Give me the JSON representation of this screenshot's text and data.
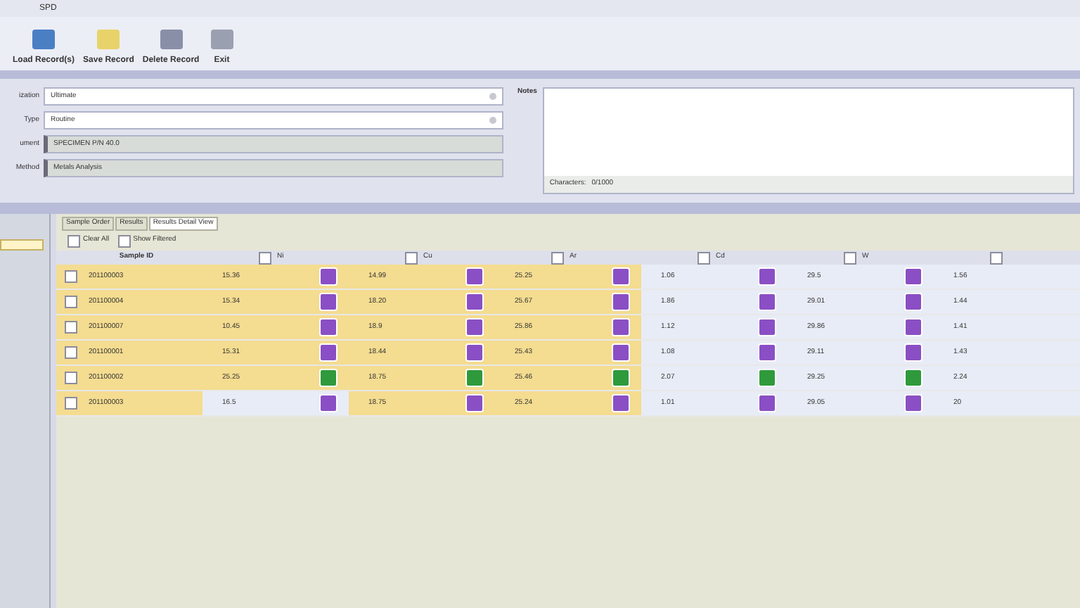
{
  "window": {
    "title": "SPD"
  },
  "toolbar": [
    {
      "label": "Load Record(s)"
    },
    {
      "label": "Save Record"
    },
    {
      "label": "Delete Record"
    },
    {
      "label": "Exit"
    }
  ],
  "form": {
    "fields": [
      {
        "label": "ization",
        "value": "Ultimate",
        "kind": "dropdown"
      },
      {
        "label": "Type",
        "value": "Routine",
        "kind": "dropdown"
      },
      {
        "label": "ument",
        "value": "SPECIMEN P/N 40.0",
        "kind": "readonly"
      },
      {
        "label": "Method",
        "value": "Metals Analysis",
        "kind": "readonly"
      }
    ],
    "notes": {
      "label": "Notes",
      "counter_label": "Characters:",
      "counter": "0/1000"
    }
  },
  "tabs": [
    {
      "label": "Sample Order",
      "selected": false
    },
    {
      "label": "Results",
      "selected": false
    },
    {
      "label": "Results Detail View",
      "selected": true
    }
  ],
  "options": [
    {
      "label": "Clear All",
      "checked": false
    },
    {
      "label": "Show Filtered",
      "checked": false
    }
  ],
  "table": {
    "id_header": "Sample ID",
    "columns": [
      {
        "label": "Ni",
        "checked": false
      },
      {
        "label": "Cu",
        "checked": false
      },
      {
        "label": "Ar",
        "checked": false
      },
      {
        "label": "Cd",
        "checked": false
      },
      {
        "label": "W",
        "checked": false
      },
      {
        "checked": false
      }
    ],
    "rows": [
      {
        "checked": false,
        "id": "201100003",
        "cells": [
          {
            "value": "15.36",
            "highlighted": true,
            "color": "#8a4fc4"
          },
          {
            "value": "14.99",
            "highlighted": true,
            "color": "#8a4fc4"
          },
          {
            "value": "25.25",
            "highlighted": true,
            "color": "#8a4fc4"
          },
          {
            "value": "1.06",
            "highlighted": false,
            "color": "#8a4fc4"
          },
          {
            "value": "29.5",
            "highlighted": false,
            "color": "#8a4fc4"
          },
          {
            "value": "1.56",
            "highlighted": false
          }
        ]
      },
      {
        "checked": false,
        "id": "201100004",
        "cells": [
          {
            "value": "15.34",
            "highlighted": true,
            "color": "#8a4fc4"
          },
          {
            "value": "18.20",
            "highlighted": true,
            "color": "#8a4fc4"
          },
          {
            "value": "25.67",
            "highlighted": true,
            "color": "#8a4fc4"
          },
          {
            "value": "1.86",
            "highlighted": false,
            "color": "#8a4fc4"
          },
          {
            "value": "29.01",
            "highlighted": false,
            "color": "#8a4fc4"
          },
          {
            "value": "1.44",
            "highlighted": false
          }
        ]
      },
      {
        "checked": false,
        "id": "201100007",
        "cells": [
          {
            "value": "10.45",
            "highlighted": true,
            "color": "#8a4fc4"
          },
          {
            "value": "18.9",
            "highlighted": true,
            "color": "#8a4fc4"
          },
          {
            "value": "25.86",
            "highlighted": true,
            "color": "#8a4fc4"
          },
          {
            "value": "1.12",
            "highlighted": false,
            "color": "#8a4fc4"
          },
          {
            "value": "29.86",
            "highlighted": false,
            "color": "#8a4fc4"
          },
          {
            "value": "1.41",
            "highlighted": false
          }
        ]
      },
      {
        "checked": false,
        "id": "201100001",
        "cells": [
          {
            "value": "15.31",
            "highlighted": true,
            "color": "#8a4fc4"
          },
          {
            "value": "18.44",
            "highlighted": true,
            "color": "#8a4fc4"
          },
          {
            "value": "25.43",
            "highlighted": true,
            "color": "#8a4fc4"
          },
          {
            "value": "1.08",
            "highlighted": false,
            "color": "#8a4fc4"
          },
          {
            "value": "29.11",
            "highlighted": false,
            "color": "#8a4fc4"
          },
          {
            "value": "1.43",
            "highlighted": false
          }
        ]
      },
      {
        "checked": false,
        "id": "201100002",
        "cells": [
          {
            "value": "25.25",
            "highlighted": true,
            "color": "#2e9a3c"
          },
          {
            "value": "18.75",
            "highlighted": true,
            "color": "#2e9a3c"
          },
          {
            "value": "25.46",
            "highlighted": true,
            "color": "#2e9a3c"
          },
          {
            "value": "2.07",
            "highlighted": false,
            "color": "#2e9a3c"
          },
          {
            "value": "29.25",
            "highlighted": false,
            "color": "#2e9a3c"
          },
          {
            "value": "2.24",
            "highlighted": false
          }
        ]
      },
      {
        "checked": false,
        "id": "201100003",
        "cells": [
          {
            "value": "16.5",
            "highlighted": false,
            "color": "#8a4fc4"
          },
          {
            "value": "18.75",
            "highlighted": true,
            "color": "#8a4fc4"
          },
          {
            "value": "25.24",
            "highlighted": true,
            "color": "#8a4fc4"
          },
          {
            "value": "1.01",
            "highlighted": false,
            "color": "#8a4fc4"
          },
          {
            "value": "29.05",
            "highlighted": false,
            "color": "#8a4fc4"
          },
          {
            "value": "20",
            "highlighted": false
          }
        ]
      }
    ]
  }
}
